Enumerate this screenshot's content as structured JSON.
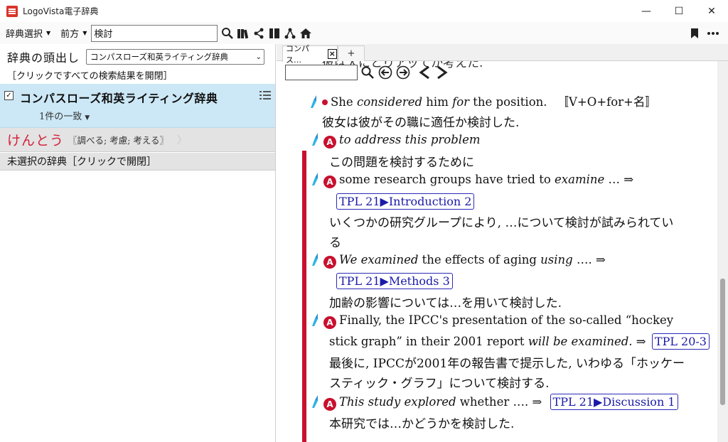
{
  "window": {
    "title": "LogoVista電子辞典",
    "minimize": "—",
    "maximize": "☐",
    "close": "✕"
  },
  "toolbar": {
    "dict_select_label": "辞典選択",
    "match_mode_label": "前方",
    "search_value": "検討",
    "icons": [
      "search-icon",
      "library-icon",
      "share-icon",
      "split-view-icon",
      "hierarchy-icon",
      "home-icon",
      "bookmark-icon",
      "more-icon"
    ]
  },
  "left": {
    "heading_label": "辞典の頭出し",
    "heading_select_value": "コンパスローズ和英ライティング辞典",
    "open_all_link": "［クリックですべての検索結果を開閉］",
    "dict_result": {
      "name": "コンパスローズ和英ライティング辞典",
      "count": "1件の一致",
      "checked": true
    },
    "entry": {
      "headword": "けんとう",
      "gloss": "〖調べる; 考慮; 考える〗",
      "arrow": "〉"
    },
    "unselected_label": "未選択の辞典［クリックで開閉］"
  },
  "right": {
    "tab_label": "コンパス…",
    "tab_close": "×",
    "tab_new": "+",
    "content": {
      "cut_line": "彼は大にとりアッてか考えた.",
      "sense": {
        "en_1": "She ",
        "en_2": "considered",
        "en_3": " him ",
        "en_4": "for",
        "en_5": " the position.",
        "pattern": "〚V+O+for+名〛",
        "ja": "彼女は彼がその職に適任か検討した."
      },
      "examples": [
        {
          "en": "to address this problem",
          "ja": "この問題を検討するために"
        },
        {
          "en_a": "some research groups have tried to ",
          "en_b": "examine",
          "en_c": " … ⇒",
          "link": "TPL 21▶Introduction 2",
          "ja_1": "いくつかの研究グループにより, …について検討が試みられてい",
          "ja_2": "る"
        },
        {
          "en_a": "We examined",
          "en_b": " the effects of aging ",
          "en_c": "using",
          "en_d": " ….  ⇒",
          "link": "TPL 21▶Methods 3",
          "ja": "加齢の影響については…を用いて検討した."
        },
        {
          "en_1": "Finally, the IPCC's presentation of the so-called “hockey",
          "en_2a": "stick graph” in their 2001 report ",
          "en_2b": "will be examined.",
          "en_2c": " ⇒",
          "link": "TPL 20-3",
          "ja_1": "最後に, IPCCが2001年の報告書で提示した, いわゆる「ホッケー",
          "ja_2": "スティック・グラフ」について検討する."
        },
        {
          "en_a": "This study explored",
          "en_b": " whether ….  ⇒ ",
          "link": "TPL 21▶Discussion 1",
          "ja": "本研究では…かどうかを検討した."
        }
      ]
    }
  },
  "colors": {
    "accent_red": "#c8102e",
    "selection_blue": "#cce8f6",
    "link_blue": "#1a1aa8"
  }
}
